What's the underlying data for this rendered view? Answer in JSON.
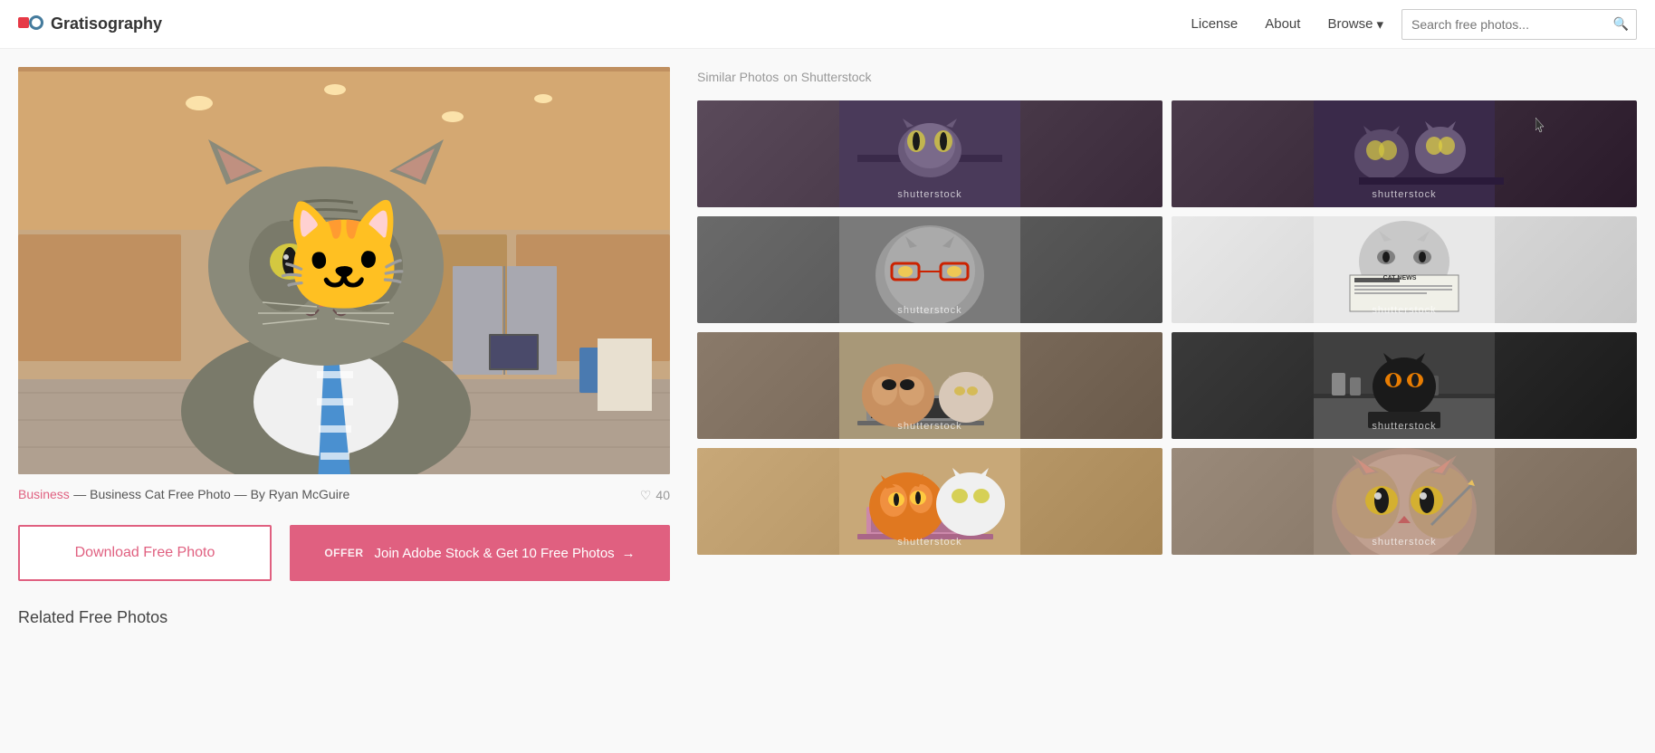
{
  "header": {
    "logo_text": "Gratisography",
    "nav": {
      "license": "License",
      "about": "About",
      "browse": "Browse",
      "browse_arrow": "▾"
    },
    "search": {
      "placeholder": "Search free photos...",
      "button_icon": "🔍"
    }
  },
  "photo": {
    "category": "Business",
    "title": "— Business Cat Free Photo — By Ryan McGuire",
    "likes": "40",
    "alt": "Business cat wearing a striped tie in an office lobby"
  },
  "buttons": {
    "download": "Download Free Photo",
    "offer_label": "OFFER",
    "offer_text": "Join Adobe Stock & Get 10 Free Photos",
    "offer_arrow": "→"
  },
  "related": {
    "title": "Related Free Photos"
  },
  "sidebar": {
    "similar_title": "Similar Photos",
    "similar_source": "on Shutterstock",
    "watermark": "shutterstock",
    "photos": [
      {
        "id": 1,
        "theme": "thumb-1",
        "emoji": "🐱"
      },
      {
        "id": 2,
        "theme": "thumb-2",
        "emoji": "🐱"
      },
      {
        "id": 3,
        "theme": "thumb-3",
        "emoji": "🐱"
      },
      {
        "id": 4,
        "theme": "thumb-4",
        "emoji": "🐱"
      },
      {
        "id": 5,
        "theme": "thumb-5",
        "emoji": "🐱"
      },
      {
        "id": 6,
        "theme": "thumb-6",
        "emoji": "🐱"
      },
      {
        "id": 7,
        "theme": "thumb-7",
        "emoji": "🐱"
      },
      {
        "id": 8,
        "theme": "thumb-8",
        "emoji": "🐱"
      }
    ]
  }
}
